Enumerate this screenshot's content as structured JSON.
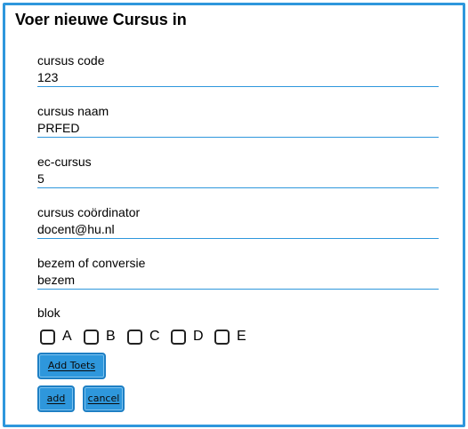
{
  "form": {
    "title": "Voer nieuwe Cursus in",
    "fields": [
      {
        "label": "cursus code",
        "value": "123"
      },
      {
        "label": "cursus naam",
        "value": "PRFED"
      },
      {
        "label": "ec-cursus",
        "value": "5"
      },
      {
        "label": "cursus coördinator",
        "value": "docent@hu.nl"
      },
      {
        "label": "bezem of conversie",
        "value": "bezem"
      }
    ],
    "blok": {
      "label": "blok",
      "options": [
        "A",
        "B",
        "C",
        "D",
        "E"
      ]
    },
    "buttons": {
      "add_toets": "Add Toets",
      "add": "add",
      "cancel": "cancel"
    }
  },
  "colors": {
    "accent": "#2e97dc",
    "button_border": "#1e7fc4",
    "text": "#000000",
    "background": "#ffffff"
  }
}
